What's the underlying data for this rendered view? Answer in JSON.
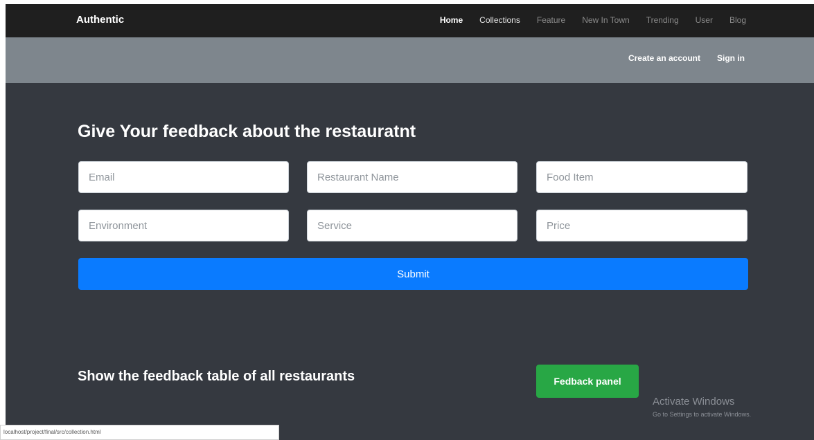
{
  "brand": "Authentic",
  "nav": {
    "home": "Home",
    "collections": "Collections",
    "feature": "Feature",
    "new_in_town": "New In Town",
    "trending": "Trending",
    "user": "User",
    "blog": "Blog"
  },
  "account": {
    "create": "Create an account",
    "signin": "Sign in"
  },
  "form": {
    "title": "Give Your feedback about the restauratnt",
    "email_placeholder": "Email",
    "restaurant_placeholder": "Restaurant Name",
    "food_placeholder": "Food Item",
    "environment_placeholder": "Environment",
    "service_placeholder": "Service",
    "price_placeholder": "Price",
    "submit_label": "Submit"
  },
  "table_section": {
    "title": "Show the feedback table of all restaurants",
    "button_label": "Fedback panel"
  },
  "watermark": {
    "title": "Activate Windows",
    "subtitle": "Go to Settings to activate Windows."
  },
  "status_url": "localhost/project/final/src/collection.html",
  "colors": {
    "nav_bg": "#1f1f1f",
    "subbar_bg": "#7e868d",
    "main_bg": "#353940",
    "primary": "#0a7bff",
    "success": "#28a745"
  }
}
